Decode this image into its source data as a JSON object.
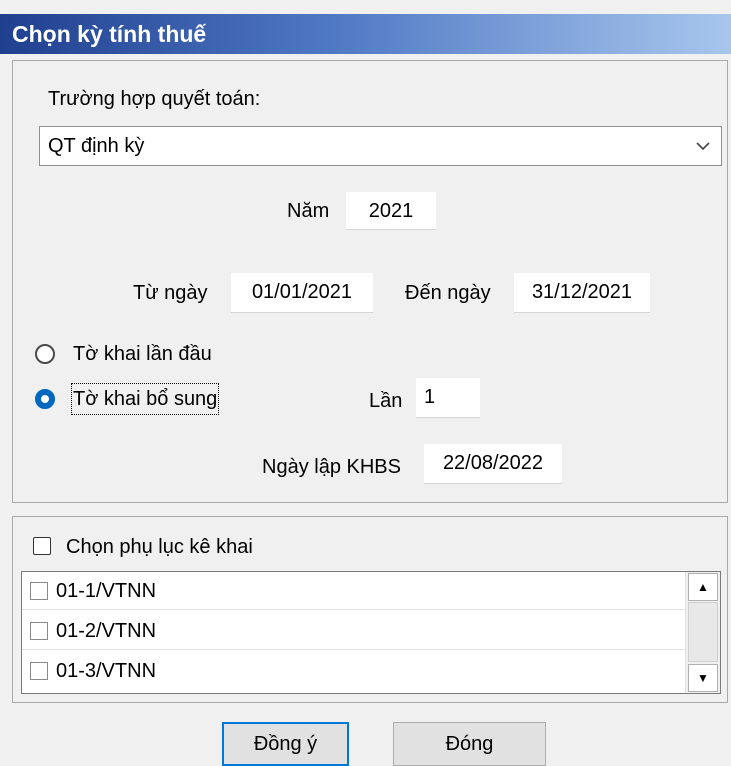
{
  "window": {
    "title": "Chọn kỳ tính thuế"
  },
  "settlement": {
    "label": "Trường hợp quyết toán:",
    "selected": "QT định kỳ",
    "arrow_icon": "chevron-down-icon"
  },
  "year": {
    "label": "Năm",
    "value": "2021"
  },
  "period": {
    "from_label": "Từ ngày",
    "from_value": "01/01/2021",
    "to_label": "Đến ngày",
    "to_value": "31/12/2021"
  },
  "declaration": {
    "first_label": "Tờ khai lần đầu",
    "first_selected": false,
    "supplement_label": "Tờ khai bổ sung",
    "supplement_selected": true,
    "times_label": "Lần",
    "times_value": "1",
    "date_label": "Ngày lập KHBS",
    "date_value": "22/08/2022"
  },
  "appendix": {
    "label": "Chọn phụ lục kê khai",
    "checked": false,
    "items": [
      {
        "label": "01-1/VTNN",
        "checked": false
      },
      {
        "label": "01-2/VTNN",
        "checked": false
      },
      {
        "label": "01-3/VTNN",
        "checked": false
      }
    ]
  },
  "buttons": {
    "ok_label": "Đồng ý",
    "close_label": "Đóng"
  },
  "colors": {
    "accent": "#0067c0",
    "title_start": "#1f3f8f",
    "title_end": "#a8c6ec"
  }
}
